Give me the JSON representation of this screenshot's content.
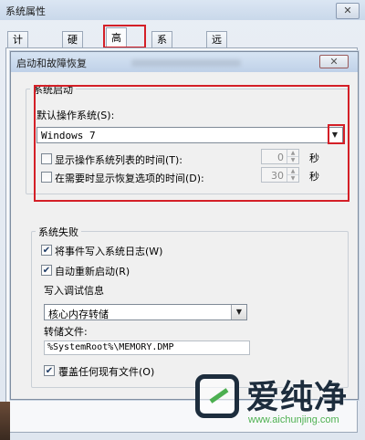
{
  "outer_window": {
    "title": "系统属性",
    "close_label": "✕",
    "tabs": [
      {
        "label": "计算机名",
        "active": false
      },
      {
        "label": "硬件",
        "active": false
      },
      {
        "label": "高级",
        "active": true
      },
      {
        "label": "系统保护",
        "active": false
      },
      {
        "label": "远程",
        "active": false
      }
    ]
  },
  "dialog": {
    "title": "启动和故障恢复",
    "close_label": "✕",
    "system_startup": {
      "legend": "系统启动",
      "default_os_label": "默认操作系统(S):",
      "default_os_value": "Windows 7",
      "show_os_list_label": "显示操作系统列表的时间(T):",
      "show_os_list_checked": false,
      "show_os_list_value": "0",
      "show_os_list_unit": "秒",
      "show_recovery_label": "在需要时显示恢复选项的时间(D):",
      "show_recovery_checked": false,
      "show_recovery_value": "30",
      "show_recovery_unit": "秒"
    },
    "system_failure": {
      "legend": "系统失败",
      "write_event_label": "将事件写入系统日志(W)",
      "write_event_checked": true,
      "auto_restart_label": "自动重新启动(R)",
      "auto_restart_checked": true,
      "debug_info_label": "写入调试信息",
      "debug_info_value": "核心内存转储",
      "dump_file_label": "转储文件:",
      "dump_file_value": "%SystemRoot%\\MEMORY.DMP",
      "overwrite_label": "覆盖任何现有文件(O)",
      "overwrite_checked": true
    }
  },
  "icons": {
    "dropdown": "▼",
    "spin_up": "▲",
    "spin_down": "▼",
    "check": "✔"
  },
  "colors": {
    "highlight_red": "#d41f27",
    "watermark_green": "#4caf50",
    "watermark_dark": "#1d2d3d"
  },
  "watermark": {
    "name": "爱纯净",
    "url": "www.aichunjing.com"
  }
}
